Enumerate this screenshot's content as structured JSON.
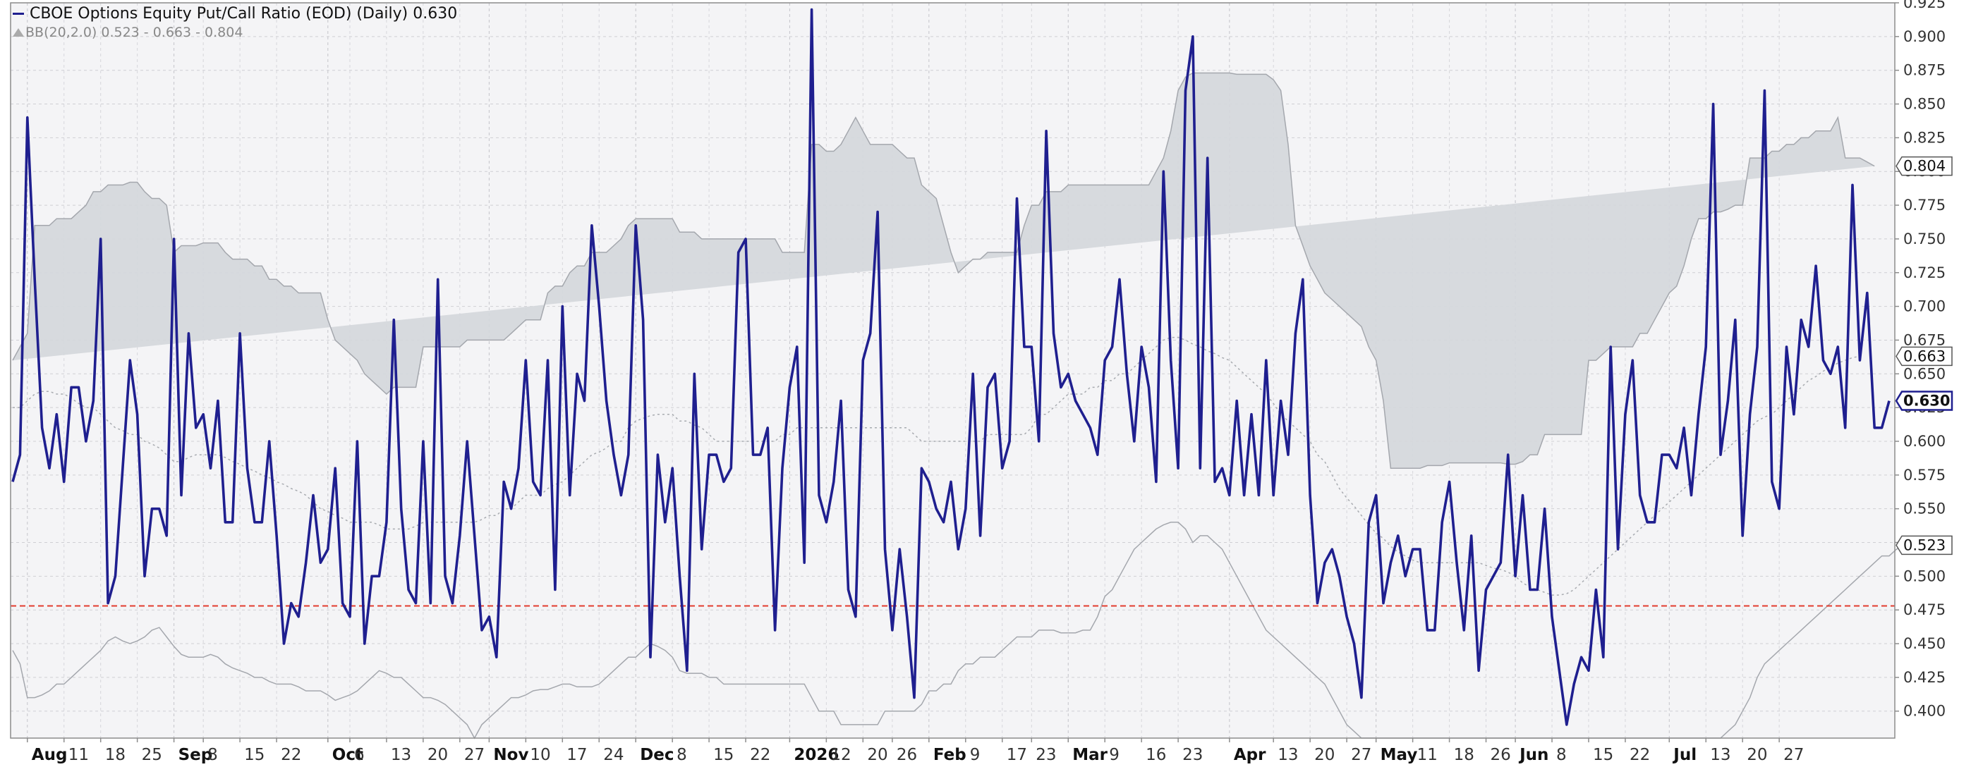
{
  "legend": {
    "main": "CBOE Options Equity Put/Call Ratio (EOD) (Daily) 0.630",
    "bb": "BB(20,2.0) 0.523 - 0.663 - 0.804"
  },
  "colors": {
    "series": "#1f1f8f",
    "band_fill": "#d4d7dc",
    "band_edge": "#a4a7ad",
    "middle": "#a8abb0",
    "reference": "#e23b2e",
    "badge_border": "#555555",
    "last_border": "#1f1f8f"
  },
  "chart_data": {
    "type": "line",
    "title": "CBOE Options Equity Put/Call Ratio (EOD) (Daily)",
    "xlabel": "",
    "ylabel": "",
    "ylim": [
      0.38,
      0.925
    ],
    "y_ticks": [
      "0.400",
      "0.425",
      "0.450",
      "0.475",
      "0.500",
      "0.525",
      "0.550",
      "0.575",
      "0.600",
      "0.625",
      "0.650",
      "0.675",
      "0.700",
      "0.725",
      "0.750",
      "0.775",
      "0.800",
      "0.825",
      "0.850",
      "0.875",
      "0.900",
      "0.925"
    ],
    "x_ticks": [
      {
        "label": "Aug",
        "i": 2,
        "bold": true
      },
      {
        "label": "11",
        "i": 7
      },
      {
        "label": "18",
        "i": 12
      },
      {
        "label": "25",
        "i": 17
      },
      {
        "label": "Sep",
        "i": 22,
        "bold": true
      },
      {
        "label": "8",
        "i": 26
      },
      {
        "label": "15",
        "i": 31
      },
      {
        "label": "22",
        "i": 36
      },
      {
        "label": "Oct",
        "i": 43,
        "bold": true
      },
      {
        "label": "6",
        "i": 46
      },
      {
        "label": "13",
        "i": 51
      },
      {
        "label": "20",
        "i": 56
      },
      {
        "label": "27",
        "i": 61
      },
      {
        "label": "Nov",
        "i": 65,
        "bold": true
      },
      {
        "label": "10",
        "i": 70
      },
      {
        "label": "17",
        "i": 75
      },
      {
        "label": "24",
        "i": 80
      },
      {
        "label": "Dec",
        "i": 85,
        "bold": true
      },
      {
        "label": "8",
        "i": 90
      },
      {
        "label": "15",
        "i": 95
      },
      {
        "label": "22",
        "i": 100
      },
      {
        "label": "2026",
        "i": 106,
        "bold": true
      },
      {
        "label": "12",
        "i": 111
      },
      {
        "label": "20",
        "i": 116
      },
      {
        "label": "26",
        "i": 120
      },
      {
        "label": "Feb",
        "i": 125,
        "bold": true
      },
      {
        "label": "9",
        "i": 130
      },
      {
        "label": "17",
        "i": 135
      },
      {
        "label": "23",
        "i": 139
      },
      {
        "label": "Mar",
        "i": 144,
        "bold": true
      },
      {
        "label": "9",
        "i": 149
      },
      {
        "label": "16",
        "i": 154
      },
      {
        "label": "23",
        "i": 159
      },
      {
        "label": "Apr",
        "i": 166,
        "bold": true
      },
      {
        "label": "13",
        "i": 172
      },
      {
        "label": "20",
        "i": 177
      },
      {
        "label": "27",
        "i": 182
      },
      {
        "label": "May",
        "i": 186,
        "bold": true
      },
      {
        "label": "11",
        "i": 191
      },
      {
        "label": "18",
        "i": 196
      },
      {
        "label": "26",
        "i": 201
      },
      {
        "label": "Jun",
        "i": 205,
        "bold": true
      },
      {
        "label": "8",
        "i": 210
      },
      {
        "label": "15",
        "i": 215
      },
      {
        "label": "22",
        "i": 220
      },
      {
        "label": "Jul",
        "i": 226,
        "bold": true
      },
      {
        "label": "13",
        "i": 231
      },
      {
        "label": "20",
        "i": 236
      },
      {
        "label": "27",
        "i": 241
      }
    ],
    "reference_line": 0.478,
    "labels": {
      "upper": {
        "value": 0.804,
        "text": "0.804"
      },
      "middle": {
        "value": 0.663,
        "text": "0.663"
      },
      "last": {
        "value": 0.63,
        "text": "0.630"
      },
      "lower": {
        "value": 0.523,
        "text": "0.523"
      }
    },
    "series": [
      {
        "name": "CBOE Options Equity Put/Call Ratio (EOD)",
        "values": [
          0.57,
          0.59,
          0.84,
          0.72,
          0.61,
          0.58,
          0.62,
          0.57,
          0.64,
          0.64,
          0.6,
          0.63,
          0.75,
          0.48,
          0.5,
          0.58,
          0.66,
          0.62,
          0.5,
          0.55,
          0.55,
          0.53,
          0.75,
          0.56,
          0.68,
          0.61,
          0.62,
          0.58,
          0.63,
          0.54,
          0.54,
          0.68,
          0.58,
          0.54,
          0.54,
          0.6,
          0.53,
          0.45,
          0.48,
          0.47,
          0.51,
          0.56,
          0.51,
          0.52,
          0.58,
          0.48,
          0.47,
          0.6,
          0.45,
          0.5,
          0.5,
          0.54,
          0.69,
          0.55,
          0.49,
          0.48,
          0.6,
          0.48,
          0.72,
          0.5,
          0.48,
          0.53,
          0.6,
          0.53,
          0.46,
          0.47,
          0.44,
          0.57,
          0.55,
          0.58,
          0.66,
          0.57,
          0.56,
          0.66,
          0.49,
          0.7,
          0.56,
          0.65,
          0.63,
          0.76,
          0.7,
          0.63,
          0.59,
          0.56,
          0.59,
          0.76,
          0.69,
          0.44,
          0.59,
          0.54,
          0.58,
          0.5,
          0.43,
          0.65,
          0.52,
          0.59,
          0.59,
          0.57,
          0.58,
          0.74,
          0.75,
          0.59,
          0.59,
          0.61,
          0.46,
          0.58,
          0.64,
          0.67,
          0.51,
          0.92,
          0.56,
          0.54,
          0.57,
          0.63,
          0.49,
          0.47,
          0.66,
          0.68,
          0.77,
          0.52,
          0.46,
          0.52,
          0.47,
          0.41,
          0.58,
          0.57,
          0.55,
          0.54,
          0.57,
          0.52,
          0.55,
          0.65,
          0.53,
          0.64,
          0.65,
          0.58,
          0.6,
          0.78,
          0.67,
          0.67,
          0.6,
          0.83,
          0.68,
          0.64,
          0.65,
          0.63,
          0.62,
          0.61,
          0.59,
          0.66,
          0.67,
          0.72,
          0.65,
          0.6,
          0.67,
          0.64,
          0.57,
          0.8,
          0.66,
          0.58,
          0.86,
          0.9,
          0.58,
          0.81,
          0.57,
          0.58,
          0.56,
          0.63,
          0.56,
          0.62,
          0.56,
          0.66,
          0.56,
          0.63,
          0.59,
          0.68,
          0.72,
          0.56,
          0.48,
          0.51,
          0.52,
          0.5,
          0.47,
          0.45,
          0.41,
          0.54,
          0.56,
          0.48,
          0.51,
          0.53,
          0.5,
          0.52,
          0.52,
          0.46,
          0.46,
          0.54,
          0.57,
          0.51,
          0.46,
          0.53,
          0.43,
          0.49,
          0.5,
          0.51,
          0.59,
          0.5,
          0.56,
          0.49,
          0.49,
          0.55,
          0.47,
          0.43,
          0.39,
          0.42,
          0.44,
          0.43,
          0.49,
          0.44,
          0.67,
          0.52,
          0.62,
          0.66,
          0.56,
          0.54,
          0.54,
          0.59,
          0.59,
          0.58,
          0.61,
          0.56,
          0.62,
          0.67,
          0.85,
          0.59,
          0.63,
          0.69,
          0.53,
          0.62,
          0.67,
          0.86,
          0.57,
          0.55,
          0.67,
          0.62,
          0.69,
          0.67,
          0.73,
          0.66,
          0.65,
          0.67,
          0.61,
          0.79,
          0.66,
          0.71,
          0.61,
          0.61,
          0.63
        ]
      }
    ],
    "bands": {
      "upper": [
        0.66,
        0.67,
        0.68,
        0.76,
        0.76,
        0.76,
        0.765,
        0.765,
        0.765,
        0.77,
        0.775,
        0.785,
        0.785,
        0.79,
        0.79,
        0.79,
        0.792,
        0.792,
        0.785,
        0.78,
        0.78,
        0.775,
        0.74,
        0.745,
        0.745,
        0.745,
        0.747,
        0.747,
        0.747,
        0.74,
        0.735,
        0.735,
        0.735,
        0.73,
        0.73,
        0.72,
        0.72,
        0.715,
        0.715,
        0.71,
        0.71,
        0.71,
        0.71,
        0.69,
        0.675,
        0.67,
        0.665,
        0.66,
        0.65,
        0.645,
        0.64,
        0.635,
        0.64,
        0.64,
        0.64,
        0.64,
        0.67,
        0.67,
        0.67,
        0.67,
        0.67,
        0.67,
        0.675,
        0.675,
        0.675,
        0.675,
        0.675,
        0.675,
        0.68,
        0.685,
        0.69,
        0.69,
        0.69,
        0.71,
        0.715,
        0.715,
        0.725,
        0.73,
        0.73,
        0.74,
        0.74,
        0.74,
        0.745,
        0.75,
        0.76,
        0.765,
        0.765,
        0.765,
        0.765,
        0.765,
        0.765,
        0.755,
        0.755,
        0.755,
        0.75,
        0.75,
        0.75,
        0.75,
        0.75,
        0.75,
        0.75,
        0.75,
        0.75,
        0.75,
        0.75,
        0.74,
        0.74,
        0.74,
        0.74,
        0.82,
        0.82,
        0.815,
        0.815,
        0.82,
        0.83,
        0.84,
        0.83,
        0.82,
        0.82,
        0.82,
        0.82,
        0.815,
        0.81,
        0.81,
        0.79,
        0.785,
        0.78,
        0.76,
        0.74,
        0.725,
        0.73,
        0.735,
        0.735,
        0.74,
        0.74,
        0.74,
        0.74,
        0.74,
        0.76,
        0.775,
        0.775,
        0.785,
        0.785,
        0.785,
        0.79,
        0.79,
        0.79,
        0.79,
        0.79,
        0.79,
        0.79,
        0.79,
        0.79,
        0.79,
        0.79,
        0.79,
        0.8,
        0.81,
        0.83,
        0.86,
        0.87,
        0.873,
        0.873,
        0.873,
        0.873,
        0.873,
        0.873,
        0.872,
        0.872,
        0.872,
        0.872,
        0.872,
        0.868,
        0.86,
        0.82,
        0.76,
        0.745,
        0.73,
        0.72,
        0.71,
        0.705,
        0.7,
        0.695,
        0.69,
        0.685,
        0.67,
        0.66,
        0.63,
        0.58,
        0.58,
        0.58,
        0.58,
        0.58,
        0.582,
        0.582,
        0.582,
        0.584,
        0.584,
        0.584,
        0.584,
        0.584,
        0.584,
        0.584,
        0.584,
        0.583,
        0.583,
        0.585,
        0.59,
        0.59,
        0.605,
        0.605,
        0.605,
        0.605,
        0.605,
        0.605,
        0.66,
        0.66,
        0.665,
        0.67,
        0.67,
        0.67,
        0.67,
        0.68,
        0.68,
        0.69,
        0.7,
        0.71,
        0.715,
        0.73,
        0.75,
        0.765,
        0.765,
        0.77,
        0.77,
        0.772,
        0.775,
        0.775,
        0.81,
        0.81,
        0.81,
        0.815,
        0.815,
        0.82,
        0.82,
        0.825,
        0.825,
        0.83,
        0.83,
        0.83,
        0.84,
        0.81,
        0.81,
        0.81,
        0.807,
        0.804
      ],
      "middle": [
        0.625,
        0.625,
        0.63,
        0.635,
        0.637,
        0.637,
        0.635,
        0.635,
        0.632,
        0.628,
        0.625,
        0.625,
        0.62,
        0.615,
        0.61,
        0.608,
        0.605,
        0.605,
        0.6,
        0.598,
        0.595,
        0.59,
        0.585,
        0.585,
        0.588,
        0.59,
        0.59,
        0.59,
        0.59,
        0.588,
        0.585,
        0.583,
        0.58,
        0.578,
        0.575,
        0.573,
        0.57,
        0.568,
        0.565,
        0.563,
        0.56,
        0.555,
        0.55,
        0.548,
        0.545,
        0.543,
        0.54,
        0.54,
        0.54,
        0.54,
        0.538,
        0.535,
        0.535,
        0.535,
        0.535,
        0.537,
        0.54,
        0.54,
        0.54,
        0.54,
        0.54,
        0.54,
        0.54,
        0.54,
        0.542,
        0.545,
        0.545,
        0.55,
        0.55,
        0.555,
        0.56,
        0.56,
        0.56,
        0.565,
        0.568,
        0.57,
        0.575,
        0.58,
        0.585,
        0.59,
        0.592,
        0.595,
        0.6,
        0.6,
        0.61,
        0.615,
        0.617,
        0.619,
        0.62,
        0.62,
        0.62,
        0.615,
        0.615,
        0.612,
        0.61,
        0.605,
        0.6,
        0.6,
        0.6,
        0.6,
        0.6,
        0.6,
        0.6,
        0.6,
        0.6,
        0.605,
        0.605,
        0.61,
        0.61,
        0.61,
        0.61,
        0.61,
        0.61,
        0.61,
        0.61,
        0.61,
        0.61,
        0.61,
        0.61,
        0.61,
        0.61,
        0.61,
        0.61,
        0.605,
        0.6,
        0.6,
        0.6,
        0.6,
        0.6,
        0.6,
        0.6,
        0.6,
        0.6,
        0.605,
        0.605,
        0.605,
        0.605,
        0.605,
        0.605,
        0.61,
        0.62,
        0.62,
        0.625,
        0.63,
        0.635,
        0.635,
        0.635,
        0.64,
        0.64,
        0.645,
        0.645,
        0.65,
        0.65,
        0.655,
        0.66,
        0.665,
        0.67,
        0.675,
        0.677,
        0.677,
        0.675,
        0.672,
        0.67,
        0.667,
        0.665,
        0.662,
        0.66,
        0.655,
        0.65,
        0.645,
        0.64,
        0.635,
        0.628,
        0.62,
        0.615,
        0.61,
        0.605,
        0.6,
        0.59,
        0.585,
        0.575,
        0.565,
        0.558,
        0.552,
        0.545,
        0.538,
        0.532,
        0.528,
        0.522,
        0.518,
        0.515,
        0.512,
        0.51,
        0.51,
        0.51,
        0.51,
        0.51,
        0.51,
        0.51,
        0.51,
        0.51,
        0.508,
        0.506,
        0.505,
        0.503,
        0.5,
        0.495,
        0.492,
        0.49,
        0.488,
        0.486,
        0.486,
        0.487,
        0.49,
        0.495,
        0.5,
        0.505,
        0.51,
        0.515,
        0.52,
        0.525,
        0.53,
        0.535,
        0.54,
        0.545,
        0.55,
        0.555,
        0.56,
        0.565,
        0.57,
        0.575,
        0.58,
        0.585,
        0.59,
        0.595,
        0.6,
        0.605,
        0.61,
        0.615,
        0.618,
        0.62,
        0.625,
        0.63,
        0.635,
        0.64,
        0.645,
        0.648,
        0.652,
        0.655,
        0.658,
        0.66,
        0.662,
        0.663
      ],
      "lower": [
        0.445,
        0.435,
        0.41,
        0.41,
        0.412,
        0.415,
        0.42,
        0.42,
        0.425,
        0.43,
        0.435,
        0.44,
        0.445,
        0.452,
        0.455,
        0.452,
        0.45,
        0.452,
        0.455,
        0.46,
        0.462,
        0.455,
        0.448,
        0.442,
        0.44,
        0.44,
        0.44,
        0.442,
        0.44,
        0.435,
        0.432,
        0.43,
        0.428,
        0.425,
        0.425,
        0.422,
        0.42,
        0.42,
        0.42,
        0.418,
        0.415,
        0.415,
        0.415,
        0.412,
        0.408,
        0.41,
        0.412,
        0.415,
        0.42,
        0.425,
        0.43,
        0.428,
        0.425,
        0.425,
        0.42,
        0.415,
        0.41,
        0.41,
        0.408,
        0.405,
        0.4,
        0.395,
        0.39,
        0.38,
        0.39,
        0.395,
        0.4,
        0.405,
        0.41,
        0.41,
        0.412,
        0.415,
        0.416,
        0.416,
        0.418,
        0.42,
        0.42,
        0.418,
        0.418,
        0.418,
        0.42,
        0.425,
        0.43,
        0.435,
        0.44,
        0.44,
        0.445,
        0.45,
        0.448,
        0.445,
        0.44,
        0.43,
        0.428,
        0.428,
        0.428,
        0.425,
        0.425,
        0.42,
        0.42,
        0.42,
        0.42,
        0.42,
        0.42,
        0.42,
        0.42,
        0.42,
        0.42,
        0.42,
        0.42,
        0.41,
        0.4,
        0.4,
        0.4,
        0.39,
        0.39,
        0.39,
        0.39,
        0.39,
        0.39,
        0.4,
        0.4,
        0.4,
        0.4,
        0.4,
        0.405,
        0.415,
        0.415,
        0.42,
        0.42,
        0.43,
        0.435,
        0.435,
        0.44,
        0.44,
        0.44,
        0.445,
        0.45,
        0.455,
        0.455,
        0.455,
        0.46,
        0.46,
        0.46,
        0.458,
        0.458,
        0.458,
        0.46,
        0.46,
        0.47,
        0.485,
        0.49,
        0.5,
        0.51,
        0.52,
        0.525,
        0.53,
        0.535,
        0.538,
        0.54,
        0.54,
        0.535,
        0.525,
        0.53,
        0.53,
        0.525,
        0.52,
        0.51,
        0.5,
        0.49,
        0.48,
        0.47,
        0.46,
        0.455,
        0.45,
        0.445,
        0.44,
        0.435,
        0.43,
        0.425,
        0.42,
        0.41,
        0.4,
        0.39,
        0.385,
        0.38,
        0.38,
        0.38,
        0.38,
        0.38,
        0.38,
        0.38,
        0.38,
        0.38,
        0.38,
        0.38,
        0.38,
        0.38,
        0.38,
        0.38,
        0.38,
        0.38,
        0.38,
        0.38,
        0.38,
        0.38,
        0.38,
        0.38,
        0.38,
        0.38,
        0.38,
        0.38,
        0.38,
        0.38,
        0.38,
        0.38,
        0.38,
        0.38,
        0.38,
        0.38,
        0.38,
        0.38,
        0.38,
        0.38,
        0.38,
        0.38,
        0.38,
        0.38,
        0.38,
        0.38,
        0.38,
        0.38,
        0.38,
        0.38,
        0.38,
        0.385,
        0.39,
        0.4,
        0.41,
        0.425,
        0.435,
        0.44,
        0.445,
        0.45,
        0.455,
        0.46,
        0.465,
        0.47,
        0.475,
        0.48,
        0.485,
        0.49,
        0.495,
        0.5,
        0.505,
        0.51,
        0.515,
        0.515,
        0.52,
        0.523
      ]
    }
  }
}
